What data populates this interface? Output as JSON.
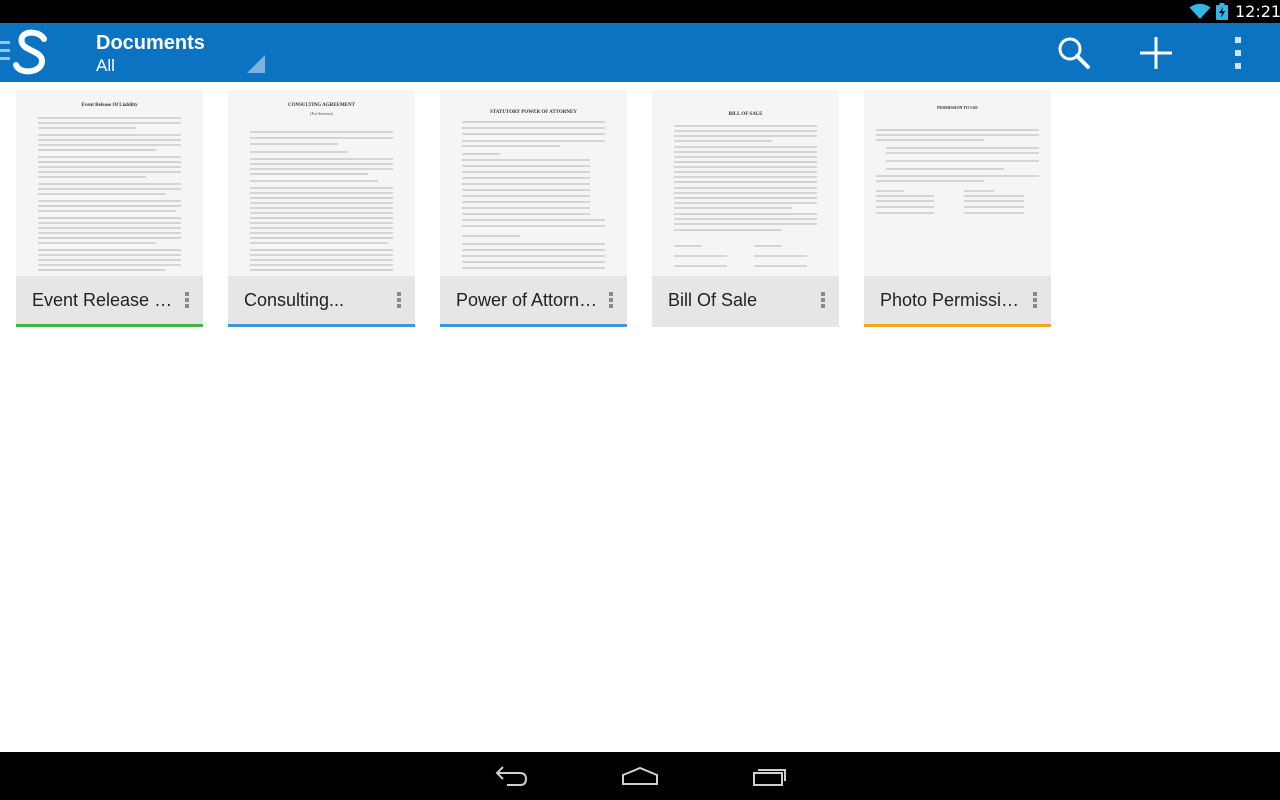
{
  "status_bar": {
    "time": "12:21",
    "icons": [
      "wifi-icon",
      "battery-charging-icon"
    ]
  },
  "action_bar": {
    "background_color": "#0b73c1",
    "logo_icon": "app-s-logo-icon",
    "title": "Documents",
    "subtitle": "All",
    "actions": [
      {
        "name": "search",
        "icon": "search-icon"
      },
      {
        "name": "add",
        "icon": "plus-icon"
      },
      {
        "name": "overflow",
        "icon": "overflow-menu-icon"
      }
    ]
  },
  "documents": [
    {
      "label": "Event Release Of...",
      "thumb_title": "Event Release Of Liability",
      "thumb_subtitle": "",
      "accent_color": "#43b649"
    },
    {
      "label": "Consulting...",
      "thumb_title": "CONSULTING AGREEMENT",
      "thumb_subtitle": "(For Services)",
      "accent_color": "#3b96db"
    },
    {
      "label": "Power of Attorney",
      "thumb_title": "STATUTORY POWER OF ATTORNEY",
      "thumb_subtitle": "",
      "accent_color": "#3b96db"
    },
    {
      "label": "Bill Of Sale",
      "thumb_title": "BILL OF SALE",
      "thumb_subtitle": "",
      "accent_color": "#e6e6e6"
    },
    {
      "label": "Photo Permissio...",
      "thumb_title": "PERMISSION TO USE",
      "thumb_subtitle": "",
      "accent_color": "#f2a81d"
    }
  ],
  "nav_bar": {
    "buttons": [
      {
        "name": "back",
        "icon": "back-icon"
      },
      {
        "name": "home",
        "icon": "home-icon"
      },
      {
        "name": "recents",
        "icon": "recent-apps-icon"
      }
    ]
  }
}
